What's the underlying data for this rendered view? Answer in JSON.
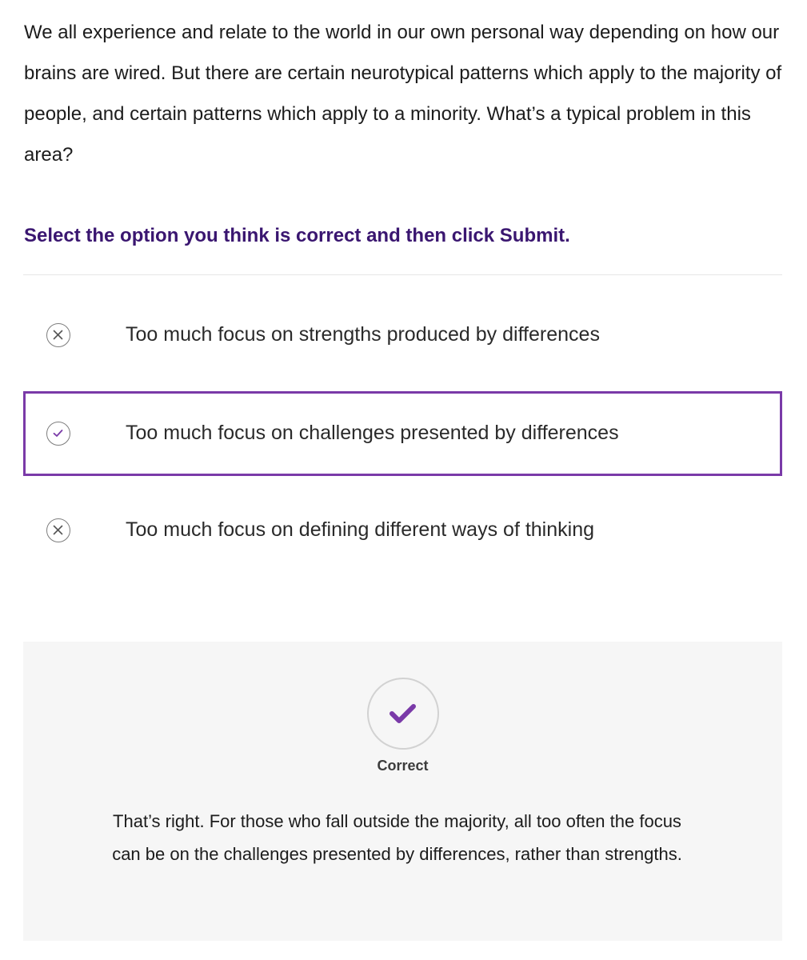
{
  "question": {
    "text": "We all experience and relate to the world in our own personal way depending on how our brains are wired. But there are certain neurotypical patterns which apply to the majority of people, and certain patterns which apply to a minority. What’s a typical problem in this area?"
  },
  "instruction": "Select the option you think is correct and then click Submit.",
  "options": [
    {
      "label": "Too much focus on strengths produced by differences",
      "icon": "x-circle-icon",
      "selected": false
    },
    {
      "label": "Too much focus on challenges presented by differences",
      "icon": "check-circle-icon",
      "selected": true
    },
    {
      "label": "Too much focus on defining different ways of thinking",
      "icon": "x-circle-icon",
      "selected": false
    }
  ],
  "feedback": {
    "icon": "checkmark-icon",
    "status": "Correct",
    "text": "That’s right. For those who fall outside the majority, all too often the focus can be on the challenges presented by differences, rather than strengths."
  },
  "colors": {
    "accent": "#7a3aa8",
    "instruction": "#3a1670",
    "feedback_bg": "#f6f6f6",
    "text": "#1c1c1c"
  }
}
